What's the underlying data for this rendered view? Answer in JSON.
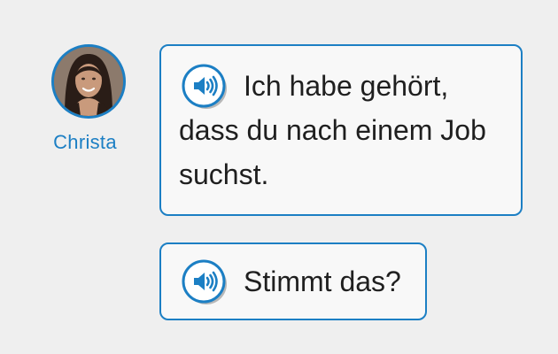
{
  "speaker": {
    "name": "Christa",
    "avatar_icon": "woman-portrait-avatar"
  },
  "messages": [
    {
      "audio_icon": "speaker-audio-icon",
      "text": "Ich habe gehört, dass du nach einem Job suchst."
    },
    {
      "audio_icon": "speaker-audio-icon",
      "text": "Stimmt das?"
    }
  ],
  "colors": {
    "accent": "#1c7fc4",
    "background": "#efefef",
    "bubble": "#f8f8f8",
    "text": "#1f1f1f"
  }
}
